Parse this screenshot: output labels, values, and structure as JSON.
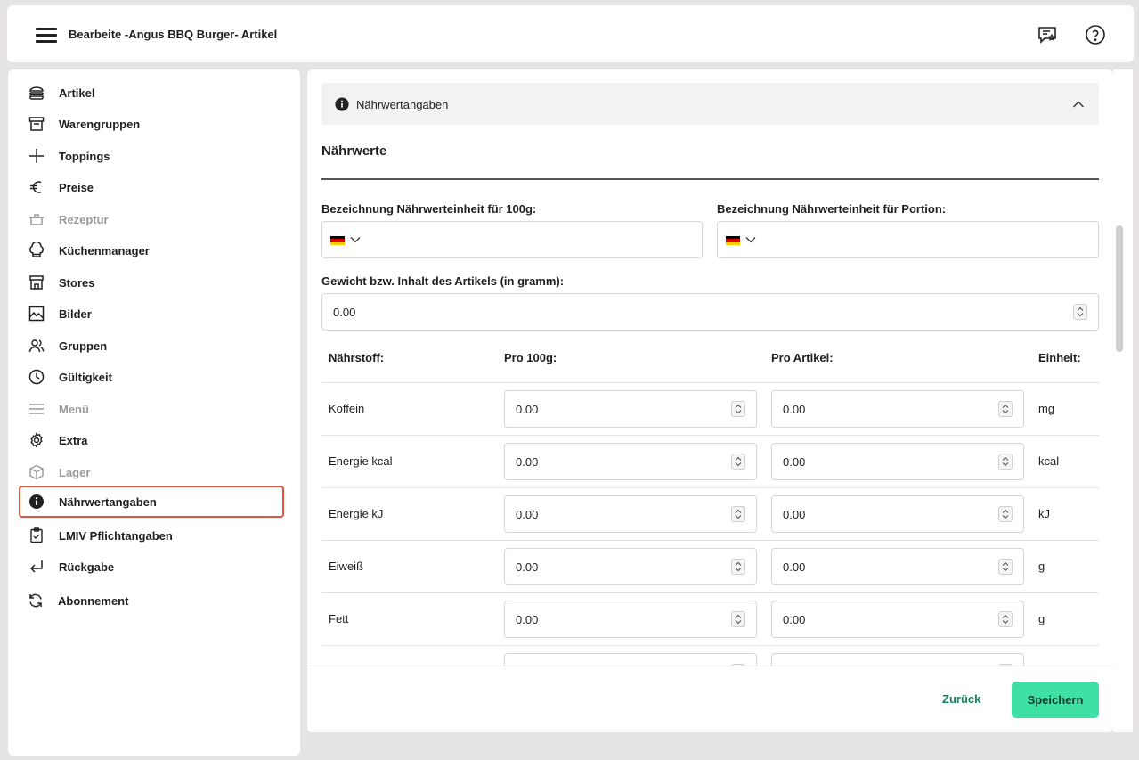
{
  "header": {
    "title": "Bearbeite -Angus BBQ Burger- Artikel",
    "menu_icon": "hamburger-menu-icon",
    "feedback_icon": "feedback-chat-icon",
    "help_icon": "help-circle-icon"
  },
  "sidebar": {
    "items": [
      {
        "label": "Artikel",
        "icon": "burger-icon",
        "disabled": false
      },
      {
        "label": "Warengruppen",
        "icon": "category-box-icon",
        "disabled": false
      },
      {
        "label": "Toppings",
        "icon": "plus-icon",
        "disabled": false
      },
      {
        "label": "Preise",
        "icon": "euro-icon",
        "disabled": false
      },
      {
        "label": "Rezeptur",
        "icon": "pot-icon",
        "disabled": true
      },
      {
        "label": "Küchenmanager",
        "icon": "chef-hat-icon",
        "disabled": false
      },
      {
        "label": "Stores",
        "icon": "store-icon",
        "disabled": false
      },
      {
        "label": "Bilder",
        "icon": "image-icon",
        "disabled": false
      },
      {
        "label": "Gruppen",
        "icon": "users-icon",
        "disabled": false
      },
      {
        "label": "Gültigkeit",
        "icon": "clock-icon",
        "disabled": false
      },
      {
        "label": "Menü",
        "icon": "menu-lines-icon",
        "disabled": true
      },
      {
        "label": "Extra",
        "icon": "gear-icon",
        "disabled": false
      },
      {
        "label": "Lager",
        "icon": "cube-icon",
        "disabled": true
      },
      {
        "label": "Nährwertangaben",
        "icon": "info-icon",
        "disabled": false,
        "active": true
      },
      {
        "label": "LMIV Pflichtangaben",
        "icon": "clipboard-check-icon",
        "disabled": false
      },
      {
        "label": "Rückgabe",
        "icon": "return-arrow-icon",
        "disabled": false
      },
      {
        "label": "Abonnement",
        "icon": "refresh-icon",
        "disabled": false
      }
    ]
  },
  "main": {
    "accordion_title": "Nährwertangaben",
    "section_title": "Nährwerte",
    "label_100g": "Bezeichnung Nährwerteinheit für 100g:",
    "label_portion": "Bezeichnung Nährwerteinheit für Portion:",
    "label_weight": "Gewicht bzw. Inhalt des Artikels (in gramm):",
    "weight_value": "0.00",
    "table": {
      "headers": [
        "Nährstoff:",
        "Pro 100g:",
        "Pro Artikel:",
        "Einheit:"
      ],
      "rows": [
        {
          "name": "Koffein",
          "per100": "0.00",
          "perItem": "0.00",
          "unit": "mg"
        },
        {
          "name": "Energie kcal",
          "per100": "0.00",
          "perItem": "0.00",
          "unit": "kcal"
        },
        {
          "name": "Energie kJ",
          "per100": "0.00",
          "perItem": "0.00",
          "unit": "kJ"
        },
        {
          "name": "Eiweiß",
          "per100": "0.00",
          "perItem": "0.00",
          "unit": "g"
        },
        {
          "name": "Fett",
          "per100": "0.00",
          "perItem": "0.00",
          "unit": "g"
        }
      ]
    }
  },
  "footer": {
    "back_label": "Zurück",
    "save_label": "Speichern"
  },
  "colors": {
    "accent": "#3fe0a4",
    "back_text": "#17805e",
    "active_border": "#e5533d"
  }
}
